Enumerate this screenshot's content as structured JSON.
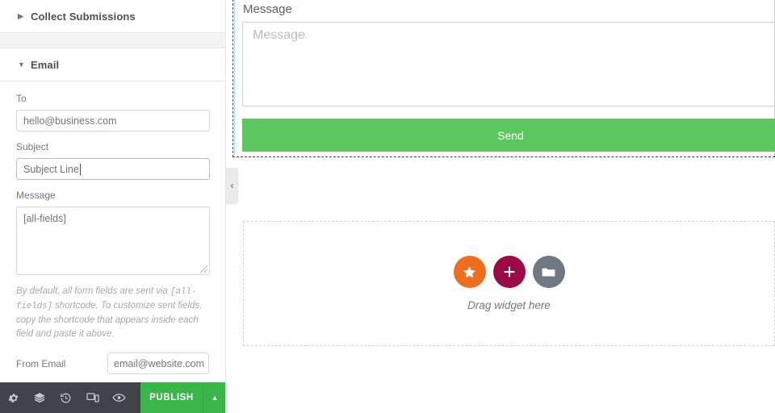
{
  "panel": {
    "sections": [
      {
        "title": "Collect Submissions",
        "arrow": "collapsed-triangle-right",
        "expanded": false
      },
      {
        "title": "Email",
        "arrow": "expanded-triangle-down",
        "expanded": true
      }
    ],
    "fields": {
      "to": {
        "label": "To",
        "value": "hello@business.com"
      },
      "subject": {
        "label": "Subject",
        "value": "Subject Line",
        "focused": true
      },
      "message": {
        "label": "Message",
        "value": "[all-fields]"
      },
      "from_email": {
        "label": "From Email",
        "value": "email@website.com"
      }
    },
    "hint": {
      "part1": "By default, all form fields are sent via ",
      "code1": "[all-fields]",
      "part2": " shortcode. To customize sent fields, copy the shortcode that appears inside each field and paste it above."
    }
  },
  "bottombar": {
    "icons": [
      {
        "name": "settings-gear-icon"
      },
      {
        "name": "layers-icon"
      },
      {
        "name": "history-revisions-icon"
      },
      {
        "name": "responsive-mode-icon"
      },
      {
        "name": "preview-eye-icon"
      }
    ],
    "publish_label": "PUBLISH",
    "publish_arrow": "▲",
    "bg_color": "#3f444b",
    "publish_color": "#39b54a"
  },
  "canvas": {
    "form": {
      "message_label": "Message",
      "message_placeholder": "Message",
      "send_label": "Send",
      "send_color": "#5cc75f"
    },
    "collapse_handle": {
      "glyph": "‹",
      "name": "collapse-panel-handle"
    },
    "dropzone": {
      "caption": "Drag widget here",
      "buttons": [
        {
          "name": "favorite-star-button",
          "icon": "star-icon",
          "color": "#ed6e20"
        },
        {
          "name": "add-new-section-button",
          "icon": "plus-icon",
          "color": "#9b0a46"
        },
        {
          "name": "templates-folder-button",
          "icon": "folder-icon",
          "color": "#6d7882"
        }
      ]
    }
  }
}
